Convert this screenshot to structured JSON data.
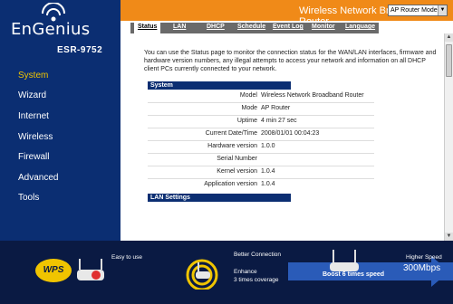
{
  "brand": {
    "name": "EnGenius",
    "model": "ESR-9752"
  },
  "nav": {
    "items": [
      {
        "label": "System",
        "active": true
      },
      {
        "label": "Wizard"
      },
      {
        "label": "Internet"
      },
      {
        "label": "Wireless"
      },
      {
        "label": "Firewall"
      },
      {
        "label": "Advanced"
      },
      {
        "label": "Tools"
      }
    ]
  },
  "header": {
    "title": "Wireless Network Broadband Router",
    "mode_select": "AP Router Mode"
  },
  "tabs": [
    "Status",
    "LAN",
    "DHCP",
    "Schedule",
    "Event Log",
    "Monitor",
    "Language"
  ],
  "content": {
    "intro": "You can use the Status page to monitor the connection status for the WAN/LAN interfaces, firmware and hardware version numbers, any illegal attempts to access your network and information on all DHCP client PCs currently connected to your network.",
    "system_section": "System",
    "lan_section": "LAN Settings",
    "rows": [
      {
        "label": "Model",
        "value": "Wireless Network Broadband Router"
      },
      {
        "label": "Mode",
        "value": "AP Router"
      },
      {
        "label": "Uptime",
        "value": "4 min 27 sec"
      },
      {
        "label": "Current Date/Time",
        "value": "2008/01/01 00:04:23"
      },
      {
        "label": "Hardware version",
        "value": "1.0.0"
      },
      {
        "label": "Serial Number",
        "value": ""
      },
      {
        "label": "Kernel version",
        "value": "1.0.4"
      },
      {
        "label": "Application version",
        "value": "1.0.4"
      }
    ]
  },
  "banner": {
    "easy": "Easy to use",
    "wps": "WPS",
    "better": "Better Connection",
    "enhance_1": "Enhance",
    "enhance_2": "3 times coverage",
    "boost": "Boost 6 times speed",
    "higher_speed": "Higher Speed",
    "speed": "300Mbps"
  }
}
